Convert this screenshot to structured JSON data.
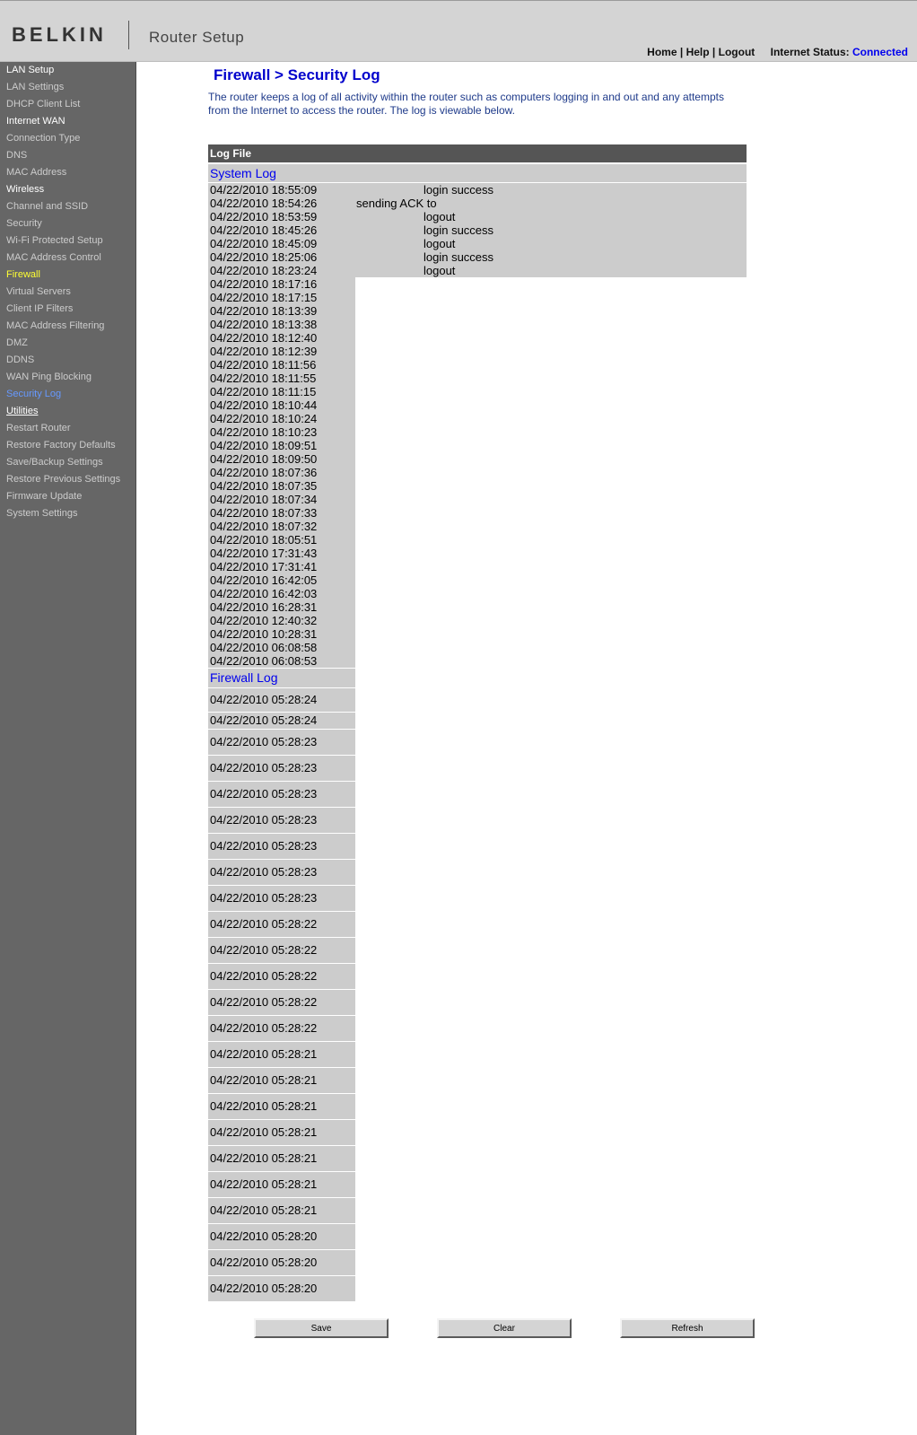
{
  "header": {
    "brand": "BELKIN",
    "app_title": "Router Setup",
    "links": [
      "Home",
      "Help",
      "Logout"
    ],
    "link_separator": "|",
    "internet_status_label": "Internet Status:",
    "internet_status_value": "Connected",
    "status_color": "#0000ee"
  },
  "sidebar": {
    "items": [
      {
        "label": "LAN Setup",
        "type": "section"
      },
      {
        "label": "LAN Settings",
        "type": "item"
      },
      {
        "label": "DHCP Client List",
        "type": "item"
      },
      {
        "label": "Internet WAN",
        "type": "section"
      },
      {
        "label": "Connection Type",
        "type": "item"
      },
      {
        "label": "DNS",
        "type": "item"
      },
      {
        "label": "MAC Address",
        "type": "item"
      },
      {
        "label": "Wireless",
        "type": "section"
      },
      {
        "label": "Channel and SSID",
        "type": "item"
      },
      {
        "label": "Security",
        "type": "item"
      },
      {
        "label": "Wi-Fi Protected Setup",
        "type": "item"
      },
      {
        "label": "MAC Address Control",
        "type": "item"
      },
      {
        "label": "Firewall",
        "type": "active-section"
      },
      {
        "label": "Virtual Servers",
        "type": "item"
      },
      {
        "label": "Client IP Filters",
        "type": "item"
      },
      {
        "label": "MAC Address Filtering",
        "type": "item"
      },
      {
        "label": "DMZ",
        "type": "item"
      },
      {
        "label": "DDNS",
        "type": "item"
      },
      {
        "label": "WAN Ping Blocking",
        "type": "item"
      },
      {
        "label": "Security Log",
        "type": "current"
      },
      {
        "label": "Utilities",
        "type": "section-underline"
      },
      {
        "label": "Restart Router",
        "type": "item"
      },
      {
        "label": "Restore Factory Defaults",
        "type": "item"
      },
      {
        "label": "Save/Backup Settings",
        "type": "item"
      },
      {
        "label": "Restore Previous Settings",
        "type": "item"
      },
      {
        "label": "Firmware Update",
        "type": "item"
      },
      {
        "label": "System Settings",
        "type": "item"
      }
    ]
  },
  "main": {
    "page_title": "Firewall > Security Log",
    "intro": "The router keeps a log of all activity within the router such as computers logging in and out and any attempts from the Internet to access the router. The log is viewable below.",
    "log_file_header": "Log File",
    "system_log_title": "System Log",
    "system_log": [
      {
        "time": "04/22/2010 18:55:09",
        "msg": "login success"
      },
      {
        "time": "04/22/2010 18:54:26",
        "msg": "sending ACK to"
      },
      {
        "time": "04/22/2010 18:53:59",
        "msg": "logout"
      },
      {
        "time": "04/22/2010 18:45:26",
        "msg": "login success"
      },
      {
        "time": "04/22/2010 18:45:09",
        "msg": "logout"
      },
      {
        "time": "04/22/2010 18:25:06",
        "msg": "login success"
      },
      {
        "time": "04/22/2010 18:23:24",
        "msg": "logout"
      },
      {
        "time": "04/22/2010 18:17:16",
        "msg": ""
      },
      {
        "time": "04/22/2010 18:17:15",
        "msg": ""
      },
      {
        "time": "04/22/2010 18:13:39",
        "msg": ""
      },
      {
        "time": "04/22/2010 18:13:38",
        "msg": ""
      },
      {
        "time": "04/22/2010 18:12:40",
        "msg": ""
      },
      {
        "time": "04/22/2010 18:12:39",
        "msg": ""
      },
      {
        "time": "04/22/2010 18:11:56",
        "msg": ""
      },
      {
        "time": "04/22/2010 18:11:55",
        "msg": ""
      },
      {
        "time": "04/22/2010 18:11:15",
        "msg": ""
      },
      {
        "time": "04/22/2010 18:10:44",
        "msg": ""
      },
      {
        "time": "04/22/2010 18:10:24",
        "msg": ""
      },
      {
        "time": "04/22/2010 18:10:23",
        "msg": ""
      },
      {
        "time": "04/22/2010 18:09:51",
        "msg": ""
      },
      {
        "time": "04/22/2010 18:09:50",
        "msg": ""
      },
      {
        "time": "04/22/2010 18:07:36",
        "msg": ""
      },
      {
        "time": "04/22/2010 18:07:35",
        "msg": ""
      },
      {
        "time": "04/22/2010 18:07:34",
        "msg": ""
      },
      {
        "time": "04/22/2010 18:07:33",
        "msg": ""
      },
      {
        "time": "04/22/2010 18:07:32",
        "msg": ""
      },
      {
        "time": "04/22/2010 18:05:51",
        "msg": ""
      },
      {
        "time": "04/22/2010 17:31:43",
        "msg": ""
      },
      {
        "time": "04/22/2010 17:31:41",
        "msg": ""
      },
      {
        "time": "04/22/2010 16:42:05",
        "msg": ""
      },
      {
        "time": "04/22/2010 16:42:03",
        "msg": ""
      },
      {
        "time": "04/22/2010 16:28:31",
        "msg": ""
      },
      {
        "time": "04/22/2010 12:40:32",
        "msg": ""
      },
      {
        "time": "04/22/2010 10:28:31",
        "msg": ""
      },
      {
        "time": "04/22/2010 06:08:58",
        "msg": ""
      },
      {
        "time": "04/22/2010 06:08:53",
        "msg": ""
      }
    ],
    "firewall_log_title": "Firewall Log",
    "firewall_log": [
      "04/22/2010 05:28:24",
      "04/22/2010 05:28:24",
      "04/22/2010 05:28:23",
      "04/22/2010 05:28:23",
      "04/22/2010 05:28:23",
      "04/22/2010 05:28:23",
      "04/22/2010 05:28:23",
      "04/22/2010 05:28:23",
      "04/22/2010 05:28:23",
      "04/22/2010 05:28:22",
      "04/22/2010 05:28:22",
      "04/22/2010 05:28:22",
      "04/22/2010 05:28:22",
      "04/22/2010 05:28:22",
      "04/22/2010 05:28:21",
      "04/22/2010 05:28:21",
      "04/22/2010 05:28:21",
      "04/22/2010 05:28:21",
      "04/22/2010 05:28:21",
      "04/22/2010 05:28:21",
      "04/22/2010 05:28:21",
      "04/22/2010 05:28:20",
      "04/22/2010 05:28:20",
      "04/22/2010 05:28:20"
    ]
  },
  "buttons": {
    "save": "Save",
    "clear": "Clear",
    "refresh": "Refresh"
  }
}
